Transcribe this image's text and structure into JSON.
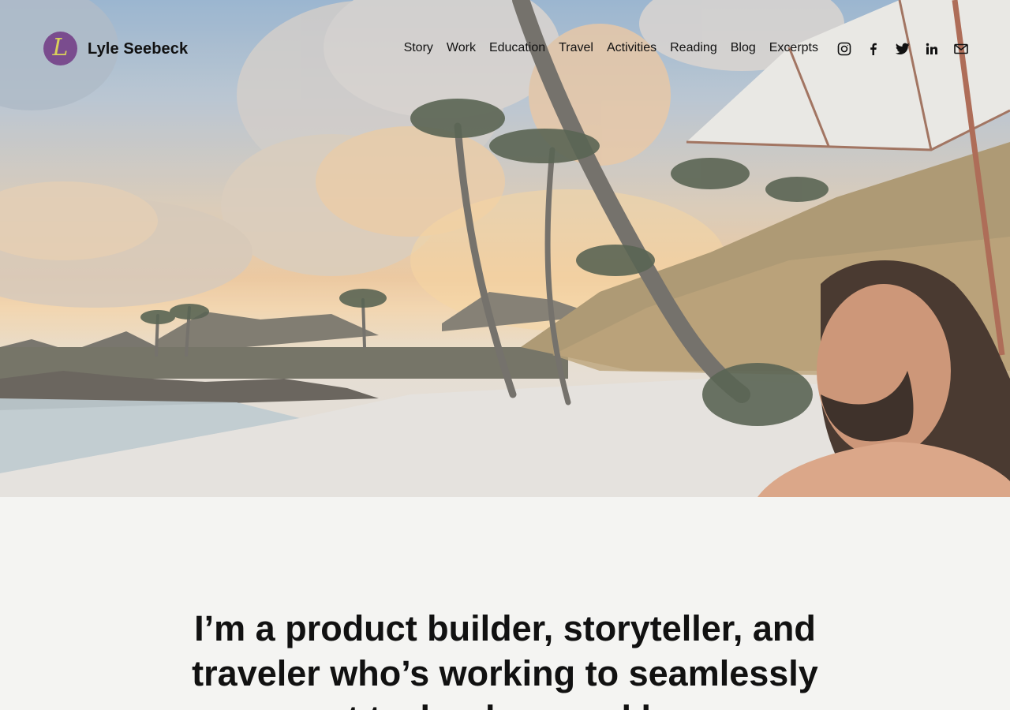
{
  "site": {
    "logo_letter": "L",
    "title": "Lyle Seebeck",
    "logo_color": "#7a4c8e",
    "logo_letter_color": "#d9d15a"
  },
  "nav": {
    "items": [
      {
        "label": "Story"
      },
      {
        "label": "Work"
      },
      {
        "label": "Education"
      },
      {
        "label": "Travel"
      },
      {
        "label": "Activities"
      },
      {
        "label": "Reading"
      },
      {
        "label": "Blog"
      },
      {
        "label": "Excerpts"
      }
    ]
  },
  "social": {
    "icons": [
      "instagram-icon",
      "facebook-icon",
      "twitter-icon",
      "linkedin-icon",
      "email-icon"
    ]
  },
  "hero": {
    "image_description_icon": "beach-photo"
  },
  "intro": {
    "headline": "I’m a product builder, storyteller, and traveler who’s working to seamlessly connect technology and humans."
  },
  "colors": {
    "page_background": "#f4f4f2",
    "text": "#111111"
  }
}
